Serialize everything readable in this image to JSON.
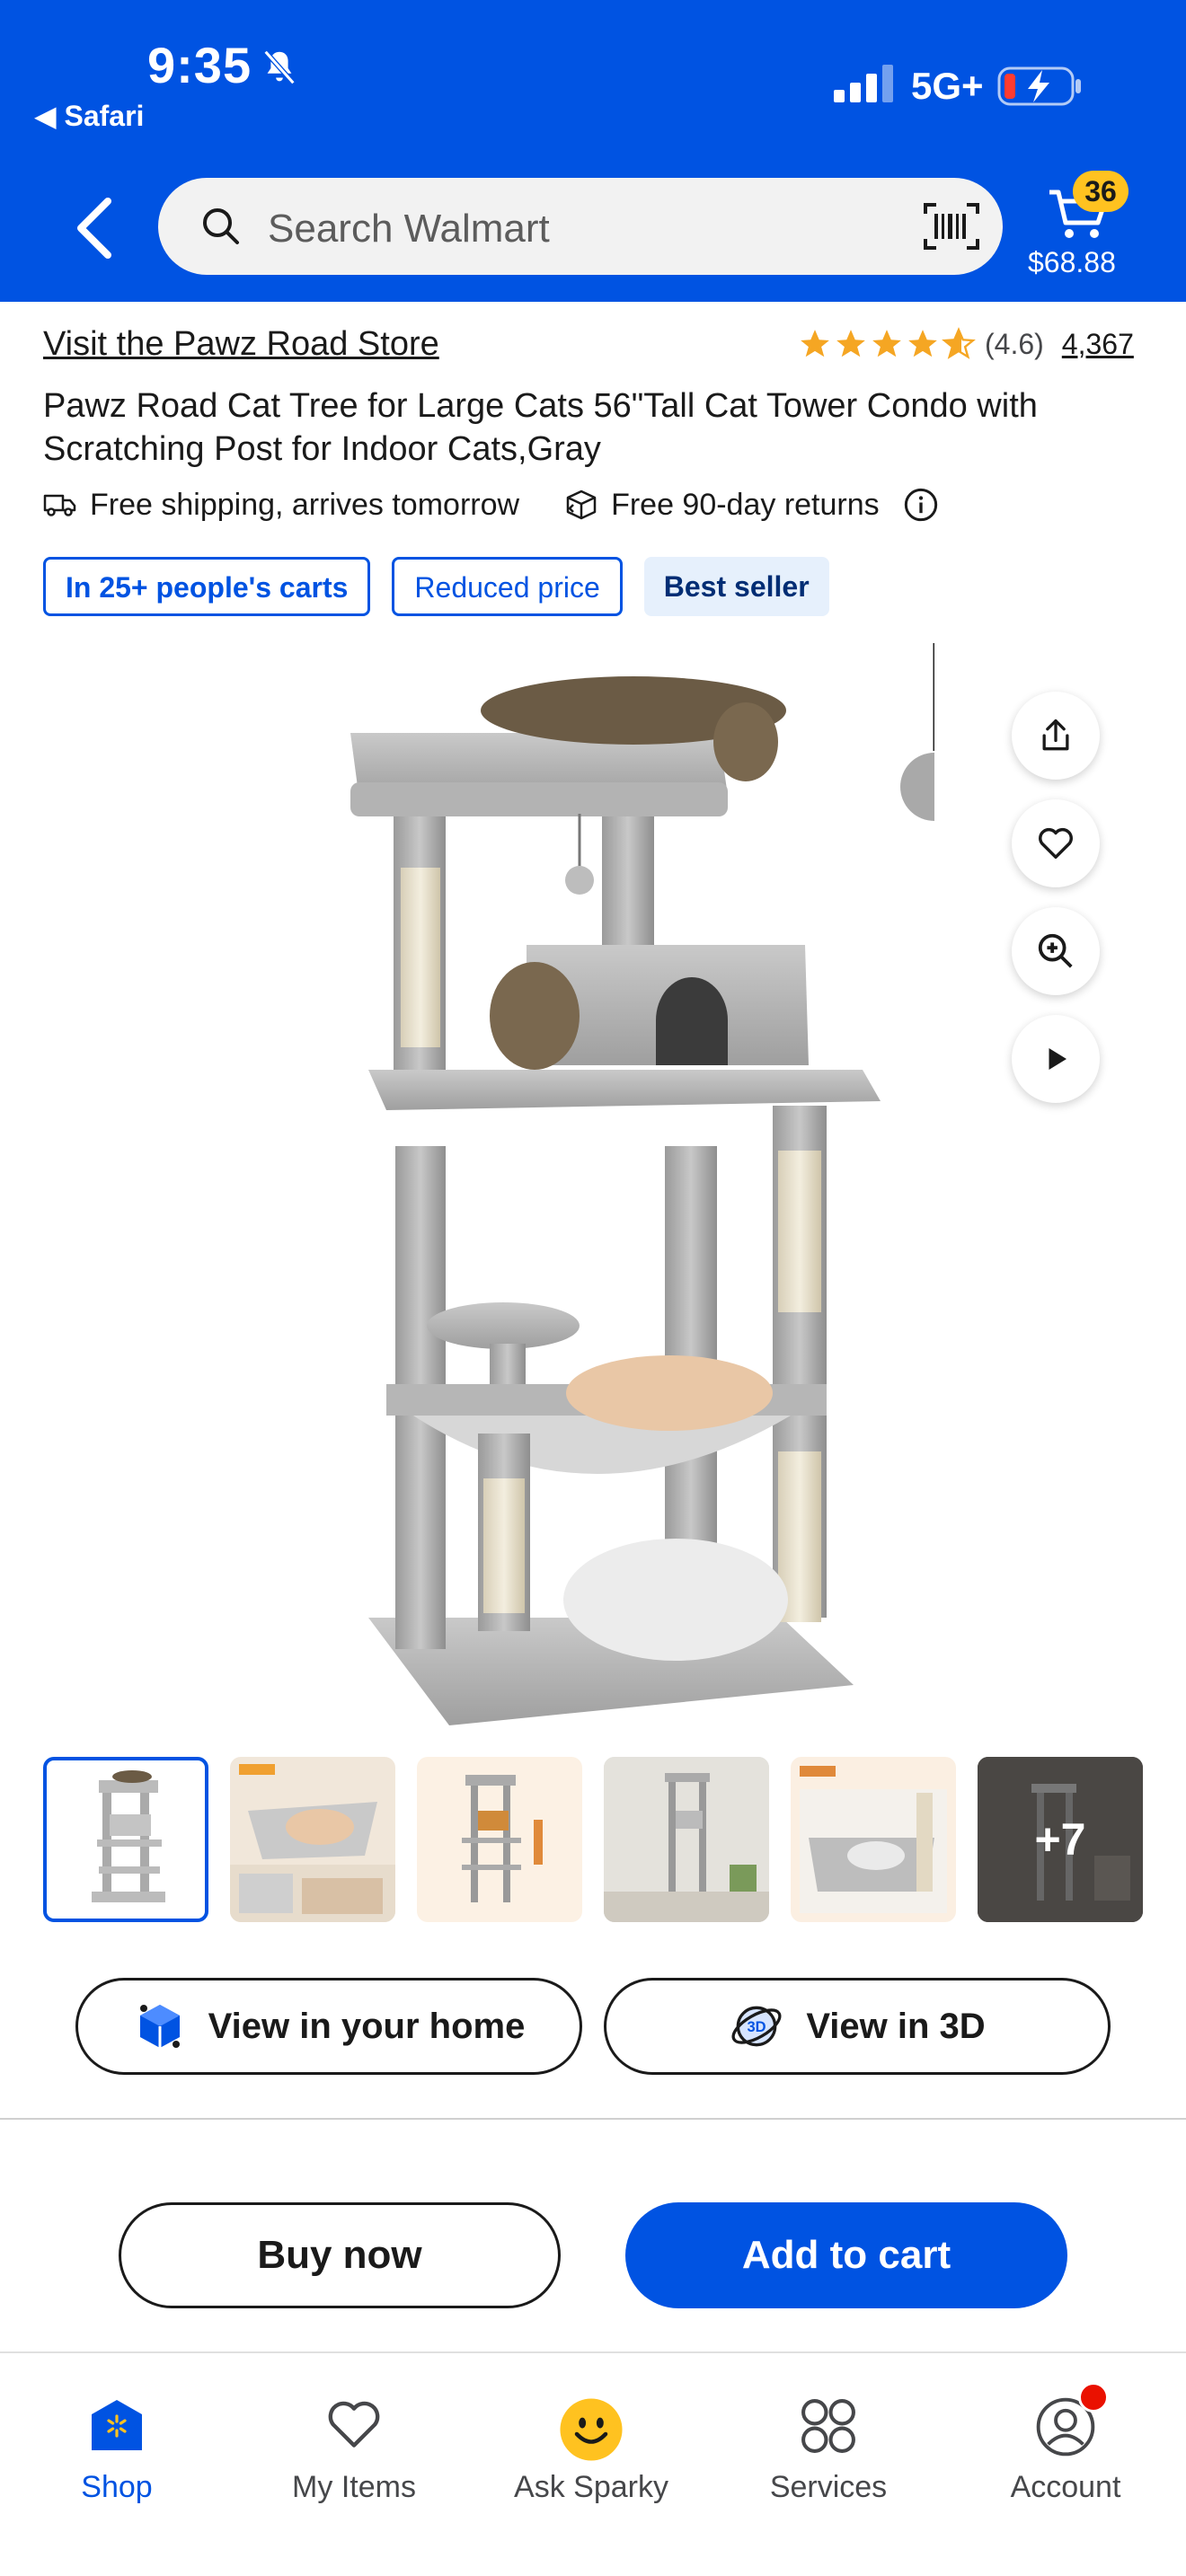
{
  "status_bar": {
    "time": "9:35",
    "back_app": "◀ Safari",
    "network": "5G+"
  },
  "header": {
    "search_placeholder": "Search Walmart",
    "cart_count": "36",
    "cart_total": "$68.88"
  },
  "product": {
    "store_link": "Visit the Pawz Road Store",
    "rating_value": "(4.6)",
    "rating_stars": 4.6,
    "review_count": "4,367",
    "title": "Pawz Road Cat Tree for Large Cats 56\"Tall Cat Tower Condo with Scratching Post for Indoor Cats,Gray",
    "shipping": "Free shipping, arrives tomorrow",
    "returns": "Free 90-day returns",
    "badges": [
      "In 25+ people's carts",
      "Reduced price",
      "Best seller"
    ]
  },
  "media": {
    "thumbnails_more": "+7",
    "view_home_label": "View in your home",
    "view_3d_label": "View in 3D"
  },
  "actions": {
    "buy_now": "Buy now",
    "add_to_cart": "Add to cart"
  },
  "tabbar": {
    "items": [
      {
        "label": "Shop",
        "icon": "shop-icon",
        "active": true
      },
      {
        "label": "My Items",
        "icon": "heart-icon",
        "active": false
      },
      {
        "label": "Ask Sparky",
        "icon": "sparky-icon",
        "active": false
      },
      {
        "label": "Services",
        "icon": "services-icon",
        "active": false
      },
      {
        "label": "Account",
        "icon": "account-icon",
        "active": false
      }
    ]
  },
  "colors": {
    "brand_blue": "#0053e2",
    "spark_yellow": "#ffc220",
    "star_color": "#f5a623"
  }
}
